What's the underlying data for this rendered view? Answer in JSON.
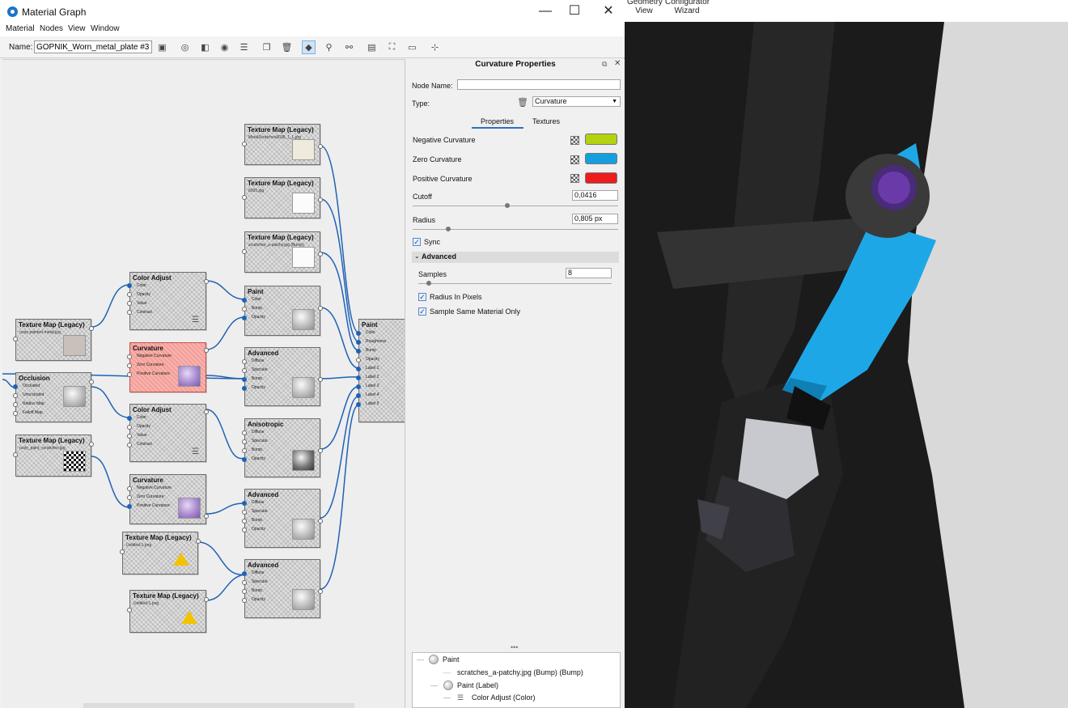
{
  "window": {
    "title": "Material Graph"
  },
  "menu": [
    "Material",
    "Nodes",
    "View",
    "Window"
  ],
  "toolbar": {
    "name_label": "Name:",
    "name_value": "GOPNIK_Worn_metal_plate #3"
  },
  "right_toolbar": {
    "geometry_view": "Geometry View",
    "configurator_wizard": "Configurator Wizard"
  },
  "graph": {
    "nodes": [
      {
        "id": "tex1",
        "title": "Texture Map (Legacy)",
        "subtitle": "MetalScratches0038_1_L.jpg"
      },
      {
        "id": "tex2",
        "title": "Texture Map (Legacy)",
        "subtitle": "6005.jpg"
      },
      {
        "id": "tex3",
        "title": "Texture Map (Legacy)",
        "subtitle": "scratches_a-patchy.jpg (Bump)"
      },
      {
        "id": "ca1",
        "title": "Color Adjust",
        "ports": [
          "Color",
          "Opacity",
          "Value",
          "Contrast"
        ]
      },
      {
        "id": "paint1",
        "title": "Paint",
        "ports": [
          "Color",
          "Bump",
          "Opacity"
        ]
      },
      {
        "id": "texL1",
        "title": "Texture Map (Legacy)",
        "subtitle": "rusty-painted-metal.jpg"
      },
      {
        "id": "curv1",
        "title": "Curvature",
        "ports": [
          "Negative Curvature",
          "Zero Curvature",
          "Positive Curvature"
        ]
      },
      {
        "id": "adv1",
        "title": "Advanced",
        "ports": [
          "Diffuse",
          "Specular",
          "Bump",
          "Opacity"
        ]
      },
      {
        "id": "occ",
        "title": "Occlusion",
        "ports": [
          "Occluded",
          "Unoccluded",
          "Radius Map",
          "Falloff Map"
        ]
      },
      {
        "id": "ca2",
        "title": "Color Adjust",
        "ports": [
          "Color",
          "Opacity",
          "Value",
          "Contrast"
        ]
      },
      {
        "id": "texL2",
        "title": "Texture Map (Legacy)",
        "subtitle": "rusty_paint_scratches.jpg"
      },
      {
        "id": "aniso",
        "title": "Anisotropic",
        "ports": [
          "Diffuse",
          "Specular",
          "Bump",
          "Opacity"
        ]
      },
      {
        "id": "curv2",
        "title": "Curvature",
        "ports": [
          "Negative Curvature",
          "Zero Curvature",
          "Positive Curvature"
        ]
      },
      {
        "id": "adv2",
        "title": "Advanced",
        "ports": [
          "Diffuse",
          "Specular",
          "Bump",
          "Opacity"
        ]
      },
      {
        "id": "texU1",
        "title": "Texture Map (Legacy)",
        "subtitle": "Untitled-1.png"
      },
      {
        "id": "adv3",
        "title": "Advanced",
        "ports": [
          "Diffuse",
          "Specular",
          "Bump",
          "Opacity"
        ]
      },
      {
        "id": "texU2",
        "title": "Texture Map (Legacy)",
        "subtitle": "Untitled-1.png"
      },
      {
        "id": "paintMain",
        "title": "Paint",
        "ports": [
          "Color",
          "Roughness",
          "Bump",
          "Opacity",
          "Label 1",
          "Label 2",
          "Label 3",
          "Label 4",
          "Label 5"
        ]
      }
    ]
  },
  "properties": {
    "title": "Curvature Properties",
    "node_name_label": "Node Name:",
    "node_name_value": "",
    "type_label": "Type:",
    "type_value": "Curvature",
    "tabs": [
      "Properties",
      "Textures"
    ],
    "negative_label": "Negative Curvature",
    "zero_label": "Zero Curvature",
    "positive_label": "Positive Curvature",
    "negative_color": "#b5d20f",
    "zero_color": "#169fe0",
    "positive_color": "#ee1c1c",
    "cutoff_label": "Cutoff",
    "cutoff_value": "0,0416",
    "radius_label": "Radius",
    "radius_value": "0,805 px",
    "sync_label": "Sync",
    "advanced_label": "Advanced",
    "samples_label": "Samples",
    "samples_value": "8",
    "radius_pixels_label": "Radius In Pixels",
    "same_material_label": "Sample Same Material Only"
  },
  "tree": [
    "Paint",
    "scratches_a-patchy.jpg (Bump) (Bump)",
    "Paint (Label)",
    "Color Adjust (Color)"
  ]
}
